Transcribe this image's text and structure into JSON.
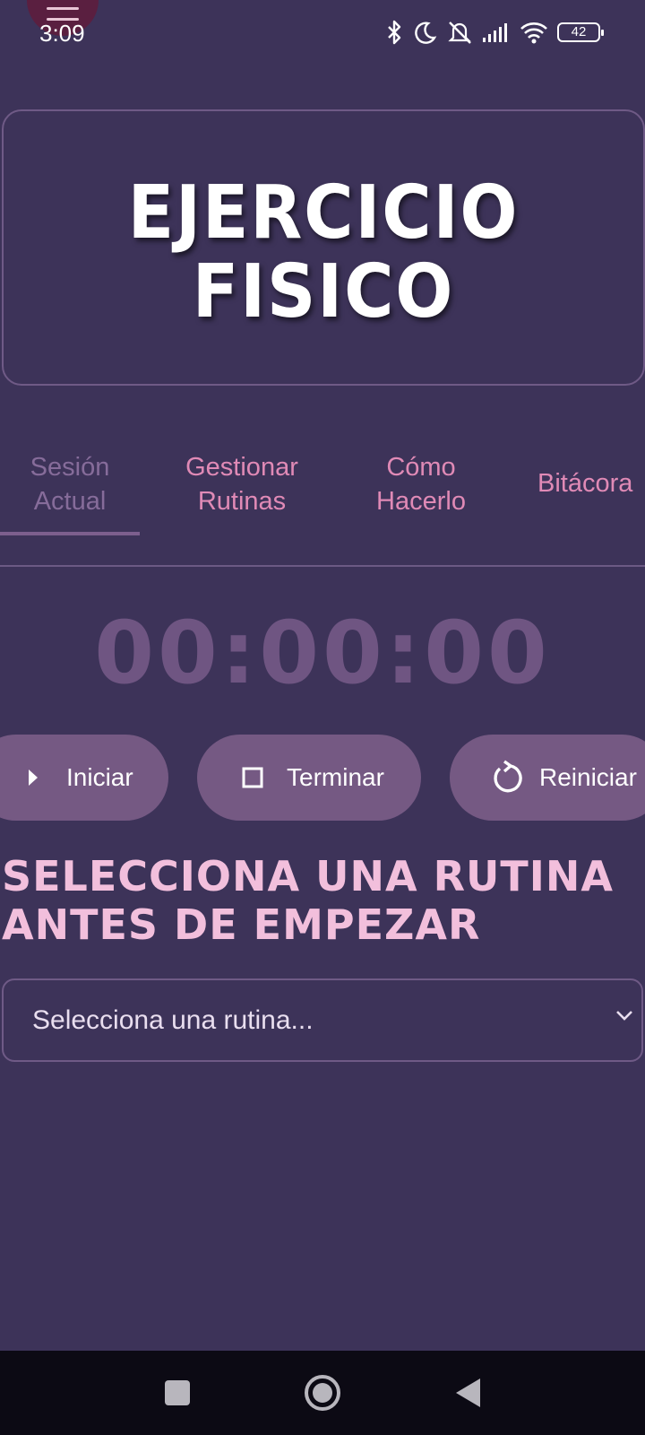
{
  "status": {
    "time": "3:09",
    "battery": "42",
    "icons": [
      "bluetooth-icon",
      "moon-icon",
      "mute-icon",
      "signal-icon",
      "wifi-icon",
      "battery-icon"
    ]
  },
  "header": {
    "menu_icon": "menu-icon",
    "title_line1": "EJERCICIO",
    "title_line2": "FISICO"
  },
  "tabs": [
    {
      "line1": "Sesión",
      "line2": "Actual",
      "active": true
    },
    {
      "line1": "Gestionar",
      "line2": "Rutinas",
      "active": false
    },
    {
      "line1": "Cómo",
      "line2": "Hacerlo",
      "active": false
    },
    {
      "line1": "Bitácora",
      "line2": "",
      "active": false
    }
  ],
  "timer": "00:00:00",
  "buttons": {
    "start": {
      "label": "Iniciar",
      "icon": "play-icon"
    },
    "end": {
      "label": "Terminar",
      "icon": "stop-icon"
    },
    "reset": {
      "label": "Reiniciar",
      "icon": "restart-icon"
    }
  },
  "select_heading": {
    "line1": "SELECCIONA UNA RUTINA",
    "line2": "ANTES DE EMPEZAR"
  },
  "routine_select": {
    "placeholder": "Selecciona una rutina...",
    "icon": "chevron-down-icon"
  },
  "nav": {
    "icons": [
      "recents-icon",
      "home-icon",
      "back-icon"
    ]
  },
  "colors": {
    "background": "#3d3359",
    "accent_pink": "#e08ab6",
    "heading_pink": "#f2bfdc",
    "button": "#755983",
    "timer": "#6f5582"
  }
}
